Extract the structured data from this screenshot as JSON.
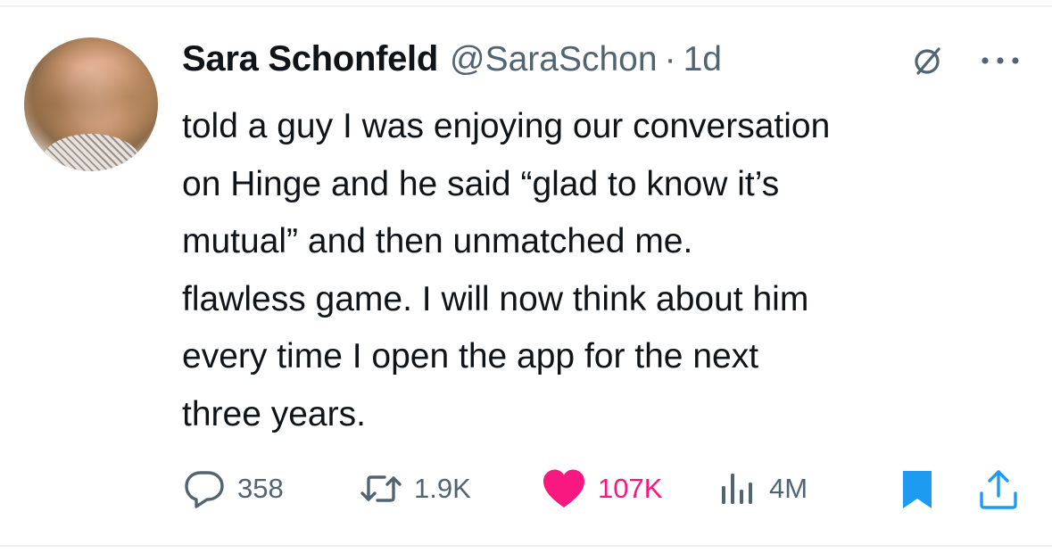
{
  "tweet": {
    "author_name": "Sara Schonfeld",
    "handle": "@SaraSchon",
    "separator": "·",
    "time": "1d",
    "text": "told a guy I was enjoying our conversation\non Hinge and he said “glad to know it’s\nmutual” and then unmatched me.\nflawless game. I will now think about him\nevery time I open the app for the next\nthree years."
  },
  "icons": {
    "verify": "circle-slash-icon",
    "more": "more-horizontal-icon",
    "reply": "reply-bubble-icon",
    "retweet": "retweet-icon",
    "like": "heart-filled-icon",
    "views": "bar-chart-icon",
    "bookmark": "bookmark-filled-icon",
    "share": "share-upload-icon"
  },
  "actions": {
    "replies": "358",
    "retweets": "1.9K",
    "likes": "107K",
    "views": "4M"
  },
  "colors": {
    "text": "#0f1419",
    "secondary": "#536471",
    "like": "#f91880",
    "accent": "#1d9bf0",
    "divider": "#eff3f4"
  }
}
